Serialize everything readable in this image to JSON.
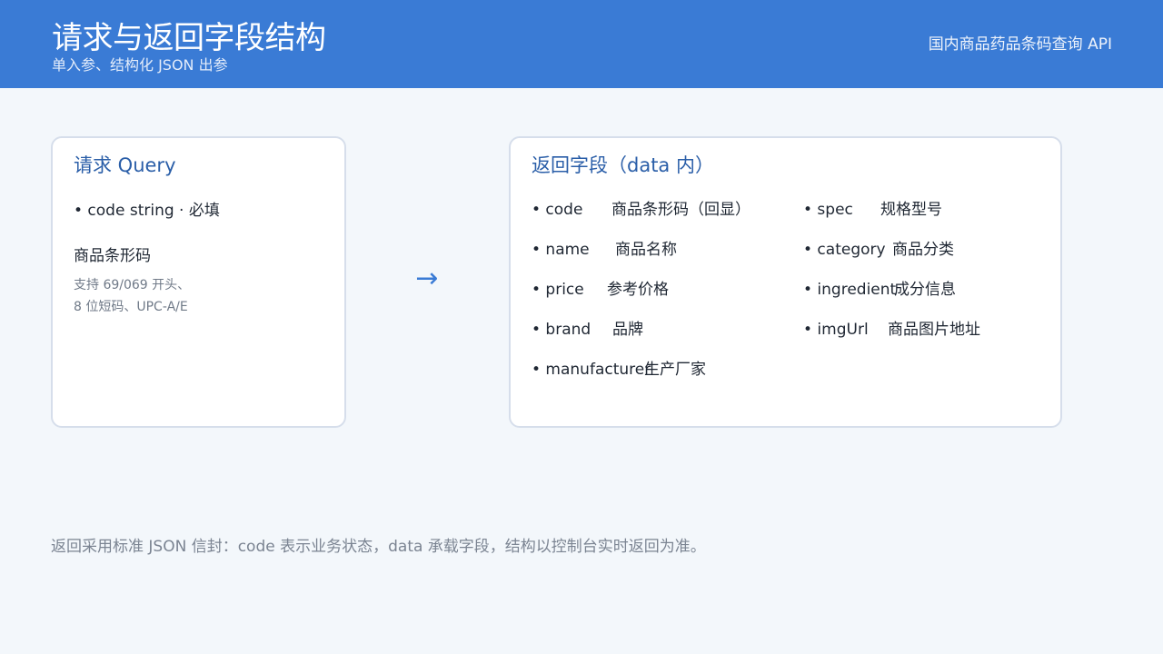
{
  "header": {
    "title": "请求与返回字段结构",
    "subtitle": "单入参、结构化 JSON 出参",
    "right_label": "国内商品药品条码查询 API"
  },
  "request_card": {
    "title": "请求 Query",
    "field_line": "• code  string · 必填",
    "description": "商品条形码",
    "note_line1": "支持 69/069 开头、",
    "note_line2": "8 位短码、UPC-A/E"
  },
  "arrow": "→",
  "response_card": {
    "title": "返回字段（data 内）",
    "left_fields": [
      {
        "name": "• code",
        "desc": "商品条形码（回显）"
      },
      {
        "name": "• name",
        "desc": "商品名称"
      },
      {
        "name": "• price",
        "desc": "参考价格"
      },
      {
        "name": "• brand",
        "desc": "品牌"
      },
      {
        "name": "• manufacturer",
        "desc": "生产厂家"
      }
    ],
    "right_fields": [
      {
        "name": "• spec",
        "desc": "规格型号"
      },
      {
        "name": "• category",
        "desc": "商品分类"
      },
      {
        "name": "• ingredient",
        "desc": "成分信息"
      },
      {
        "name": "• imgUrl",
        "desc": "商品图片地址"
      }
    ]
  },
  "footer": {
    "note": "返回采用标准 JSON 信封：code 表示业务状态，data 承载字段，结构以控制台实时返回为准。"
  }
}
